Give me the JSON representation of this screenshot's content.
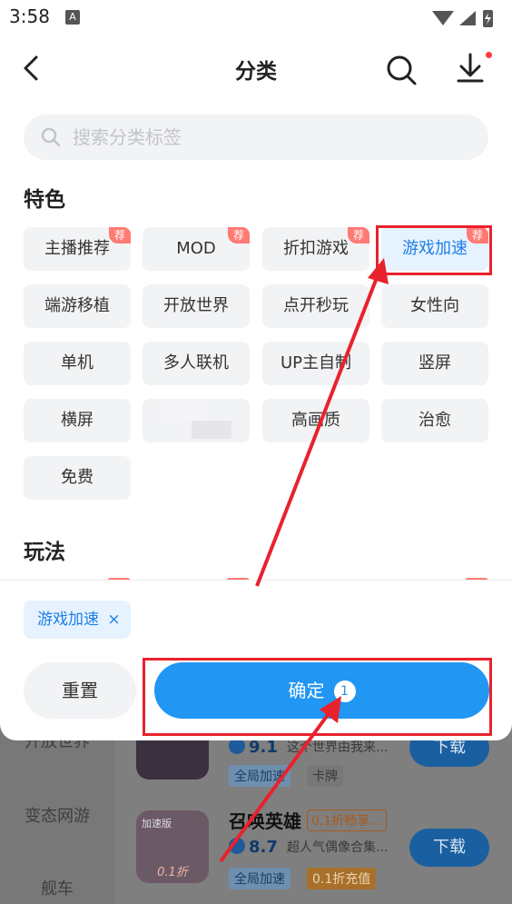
{
  "status": {
    "time": "3:58",
    "notif": "A"
  },
  "header": {
    "title": "分类"
  },
  "search": {
    "placeholder": "搜索分类标签"
  },
  "sections": {
    "features": "特色",
    "gameplay": "玩法"
  },
  "tags": [
    {
      "label": "主播推荐",
      "badge": "荐"
    },
    {
      "label": "MOD",
      "badge": "荐"
    },
    {
      "label": "折扣游戏",
      "badge": "荐"
    },
    {
      "label": "游戏加速",
      "badge": "荐"
    },
    {
      "label": "端游移植"
    },
    {
      "label": "开放世界"
    },
    {
      "label": "点开秒玩"
    },
    {
      "label": "女性向"
    },
    {
      "label": "单机"
    },
    {
      "label": "多人联机"
    },
    {
      "label": "UP主自制"
    },
    {
      "label": "竖屏"
    },
    {
      "label": "横屏"
    },
    {
      "label": ""
    },
    {
      "label": "高画质"
    },
    {
      "label": "治愈"
    },
    {
      "label": "免费"
    }
  ],
  "sheet": {
    "selected_tag": "游戏加速",
    "remove_glyph": "×",
    "reset_label": "重置",
    "confirm_label": "确定",
    "confirm_count": "1"
  },
  "background": {
    "sidebar": [
      "开放世界",
      "变态网游",
      "舰车"
    ],
    "games": [
      {
        "name": "",
        "score": "9.1",
        "desc": "这个世界由我来...",
        "chips": [
          "全局加速",
          "卡牌"
        ],
        "button": "下载"
      },
      {
        "name": "召唤英雄",
        "promo": "0.1折畅享...",
        "score": "8.7",
        "desc": "超人气偶像合集...",
        "chips": [
          "全局加速",
          "0.1折充值"
        ],
        "icon_text_top": "加速版",
        "icon_text_bottom": "0.1折",
        "button": "下载"
      }
    ]
  },
  "colors": {
    "accent": "#2196f3",
    "active_tag_bg": "#e6f3ff",
    "badge": "#ff7a73",
    "annotation": "#e8222d"
  }
}
